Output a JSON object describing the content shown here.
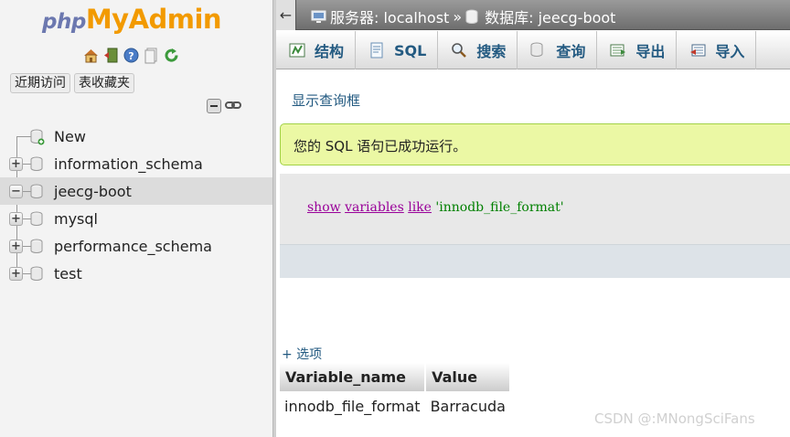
{
  "logo": {
    "php": "php",
    "myadmin": "MyAdmin"
  },
  "logo_icons": [
    "home-icon",
    "exit-icon",
    "help-icon",
    "docs-icon",
    "reload-icon"
  ],
  "nav_tabs": [
    "近期访问",
    "表收藏夹"
  ],
  "tree": {
    "items": [
      {
        "label": "New",
        "expander": "",
        "icon": "new-db-icon"
      },
      {
        "label": "information_schema",
        "expander": "+",
        "icon": "database-icon"
      },
      {
        "label": "jeecg-boot",
        "expander": "−",
        "icon": "database-icon",
        "selected": true
      },
      {
        "label": "mysql",
        "expander": "+",
        "icon": "database-icon"
      },
      {
        "label": "performance_schema",
        "expander": "+",
        "icon": "database-icon"
      },
      {
        "label": "test",
        "expander": "+",
        "icon": "database-icon"
      }
    ]
  },
  "breadcrumb": {
    "back": "←",
    "server_label": "服务器: localhost",
    "separator": "»",
    "database_label": "数据库: jeecg-boot"
  },
  "tabs": [
    {
      "label": "结构",
      "icon": "structure-icon"
    },
    {
      "label": "SQL",
      "icon": "sql-icon"
    },
    {
      "label": "搜索",
      "icon": "search-icon"
    },
    {
      "label": "查询",
      "icon": "query-icon"
    },
    {
      "label": "导出",
      "icon": "export-icon"
    },
    {
      "label": "导入",
      "icon": "import-icon"
    }
  ],
  "show_query_link": "显示查询框",
  "success_message": "您的 SQL 语句已成功运行。",
  "sql": {
    "kw1": "show",
    "kw2": "variables",
    "kw3": "like",
    "str": "'innodb_file_format'"
  },
  "options_link": "+ 选项",
  "result": {
    "columns": [
      "Variable_name",
      "Value"
    ],
    "rows": [
      [
        "innodb_file_format",
        "Barracuda"
      ]
    ]
  },
  "watermark": "CSDN @:MNongSciFans",
  "colors": {
    "accent": "#235a81",
    "success_bg": "#ebf8a4",
    "logo_orange": "#f29a00",
    "logo_blue": "#6c78af"
  }
}
